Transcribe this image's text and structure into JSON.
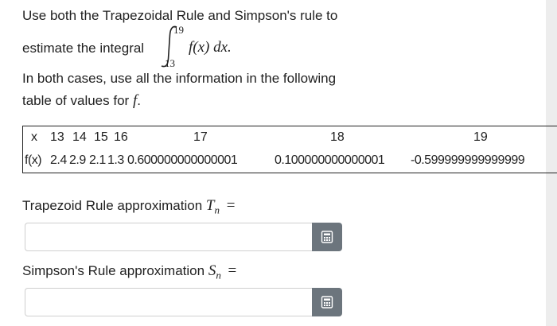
{
  "intro": {
    "line1": "Use both the Trapezoidal Rule and Simpson's rule to",
    "line2_prefix": "estimate the integral",
    "integrand": "f(x) dx.",
    "upper_limit": "19",
    "lower_limit": "13",
    "line3": "In both cases, use all the information in the following",
    "line4_prefix": "table of values for",
    "line4_var": "f",
    "line4_suffix": "."
  },
  "table": {
    "x_label": "x",
    "x_values": [
      "13",
      "14",
      "15",
      "16",
      "17",
      "18",
      "19"
    ],
    "fx_label": "f(x)",
    "fx_values": [
      "2.4",
      "2.9",
      "2.1",
      "1.3",
      "0.600000000000001",
      "0.100000000000001",
      "-0.599999999999999"
    ]
  },
  "trapezoid": {
    "label": "Trapezoid Rule approximation",
    "symbol": "T",
    "subscript": "n",
    "equals": "=",
    "value": ""
  },
  "simpson": {
    "label": "Simpson's Rule approximation",
    "symbol": "S",
    "subscript": "n",
    "equals": "=",
    "value": ""
  },
  "icons": {
    "calculator": "calculator-icon",
    "integral": "integral-sign-icon"
  },
  "colors": {
    "button": "#6c757d",
    "background": "#ededed"
  }
}
